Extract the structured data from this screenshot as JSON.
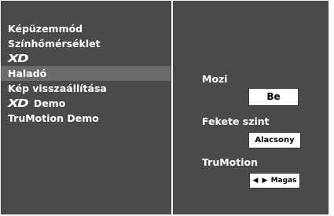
{
  "menu": {
    "items": [
      {
        "label": "Képüzemmód"
      },
      {
        "label": "Színhőmérséklet"
      },
      {
        "label": "XD"
      },
      {
        "label": "Haladó"
      },
      {
        "label": "Kép visszaállítása"
      },
      {
        "label": "XD",
        "suffix": "Demo"
      },
      {
        "label": "TruMotion Demo"
      }
    ],
    "selected_index": 3
  },
  "settings": {
    "mozi": {
      "label": "Mozi",
      "value": "Be"
    },
    "fekete_szint": {
      "label": "Fekete szint",
      "value": "Alacsony"
    },
    "trumotion": {
      "label": "TruMotion",
      "arrows": "◀ ▶",
      "value": "Magas"
    }
  },
  "colors": {
    "panel_bg": "#4a4a4a",
    "selected_bg": "#6b6b6b",
    "text": "#ffffff",
    "value_box_bg": "#ffffff",
    "divider": "#f5f5f5"
  }
}
